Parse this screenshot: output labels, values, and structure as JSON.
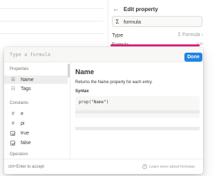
{
  "property_panel": {
    "title": "Edit property",
    "name_icon": "Σ",
    "name_value": "formula",
    "type_label": "Type",
    "type_icon": "Σ",
    "type_value": "Formula",
    "formula_label": "Formula",
    "formula_action": "Edit",
    "accent_color": "#e0257f"
  },
  "formula_editor": {
    "input_placeholder": "Type a formula",
    "done_label": "Done",
    "done_color": "#2383e2"
  },
  "list": {
    "properties_header": "Properties",
    "properties": [
      {
        "label": "Name",
        "icon": "text-lines-icon",
        "glyph": "☰",
        "selected": true
      },
      {
        "label": "Tags",
        "icon": "list-icon",
        "glyph": "☷",
        "selected": false
      }
    ],
    "constants_header": "Constants",
    "constants": [
      {
        "label": "e",
        "icon": "hash-icon",
        "glyph": "#"
      },
      {
        "label": "pi",
        "icon": "hash-icon",
        "glyph": "#"
      },
      {
        "label": "true",
        "icon": "checkbox-checked-icon"
      },
      {
        "label": "false",
        "icon": "checkbox-checked-icon"
      }
    ],
    "operators_header": "Operators"
  },
  "detail": {
    "title": "Name",
    "description": "Returns the Name property for each entry.",
    "syntax_label": "Syntax",
    "syntax_code": "prop(\"Name\")"
  },
  "footer": {
    "hint": "ctrl+Enter to accept",
    "help_icon": "?",
    "help_label": "Learn more about formulas"
  }
}
